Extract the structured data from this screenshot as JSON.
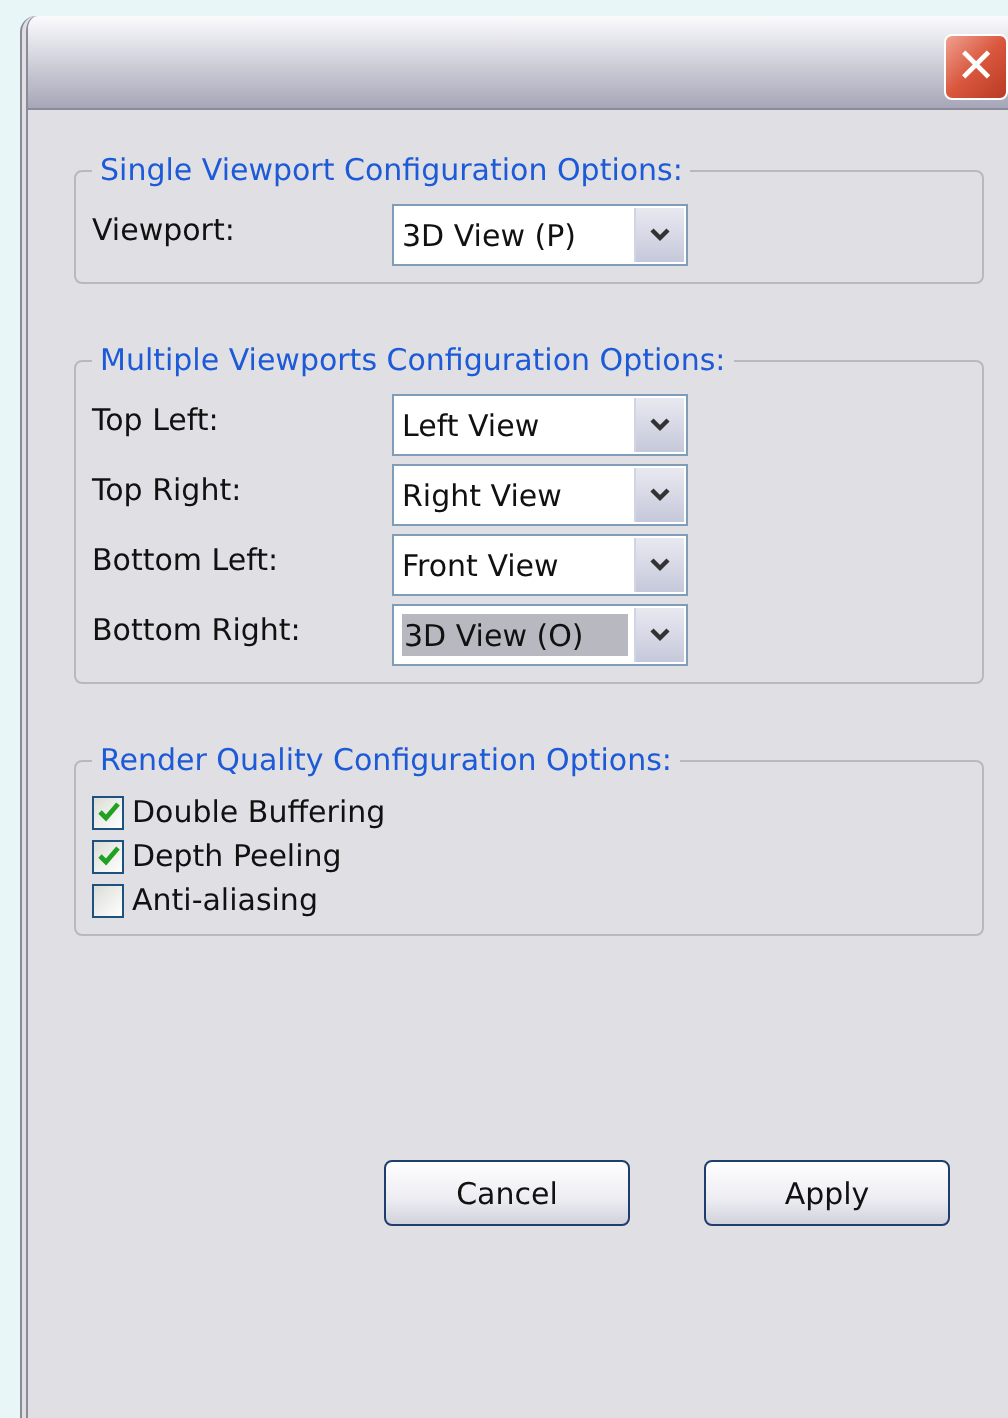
{
  "window": {
    "close_button": "✕"
  },
  "groups": [
    {
      "kind": "combos",
      "title": "Single Viewport Configuration Options:",
      "rows": [
        {
          "label": "Viewport:",
          "value": "3D View (P)",
          "focused": false
        }
      ]
    },
    {
      "kind": "combos",
      "title": "Multiple Viewports Configuration Options:",
      "rows": [
        {
          "label": "Top Left:",
          "value": "Left View",
          "focused": false
        },
        {
          "label": "Top Right:",
          "value": "Right View",
          "focused": false
        },
        {
          "label": "Bottom Left:",
          "value": "Front View",
          "focused": false
        },
        {
          "label": "Bottom Right:",
          "value": "3D View (O)",
          "focused": true
        }
      ]
    },
    {
      "kind": "checks",
      "title": "Render Quality Configuration Options:",
      "rows": [
        {
          "label": "Double Buffering",
          "checked": true
        },
        {
          "label": "Depth Peeling",
          "checked": true
        },
        {
          "label": "Anti-aliasing",
          "checked": false
        }
      ]
    }
  ],
  "buttons": [
    "Cancel",
    "Apply"
  ]
}
